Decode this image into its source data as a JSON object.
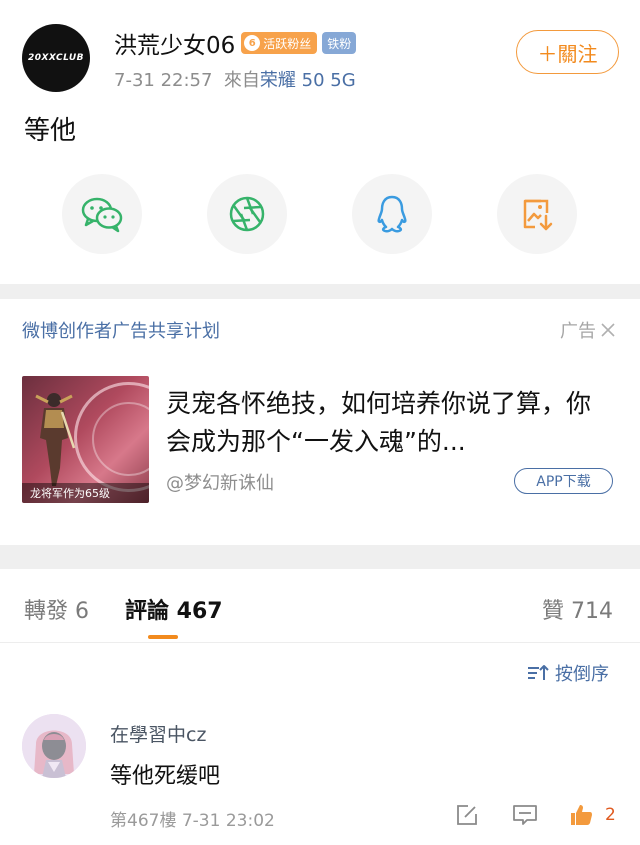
{
  "post": {
    "avatar_text": "20XXCLUB",
    "username": "洪荒少女06",
    "fan_level": "6",
    "fan_badge": "活跃粉丝",
    "iron_badge": "铁粉",
    "timestamp": "7-31 22:57",
    "source_prefix": "來自",
    "device": "荣耀 50 5G",
    "follow_label": "＋關注",
    "text": "等他"
  },
  "share_icons": [
    "wechat-icon",
    "moments-icon",
    "qq-icon",
    "save-image-icon"
  ],
  "ad": {
    "header": "微博创作者广告共享计划",
    "tag": "广告",
    "thumb_caption": "龙将军作为65级",
    "title": "灵宠各怀绝技，如何培养你说了算，你会成为那个“一发入魂”的...",
    "source": "@梦幻新诛仙",
    "app_button": "APP下载"
  },
  "tabs": {
    "repost": "轉發 6",
    "comments": "評論 467",
    "likes": "贊 714"
  },
  "sort_label": "按倒序",
  "comment": {
    "user": "在學習中cz",
    "text": "等他死缓吧",
    "floor": "第467樓",
    "time": "7-31 23:02",
    "like_count": "2"
  },
  "colors": {
    "accent_orange": "#f28a1d",
    "link_blue": "#4a6fa5",
    "fan_badge": "#f7a24b",
    "iron_badge": "#86a8d6"
  }
}
